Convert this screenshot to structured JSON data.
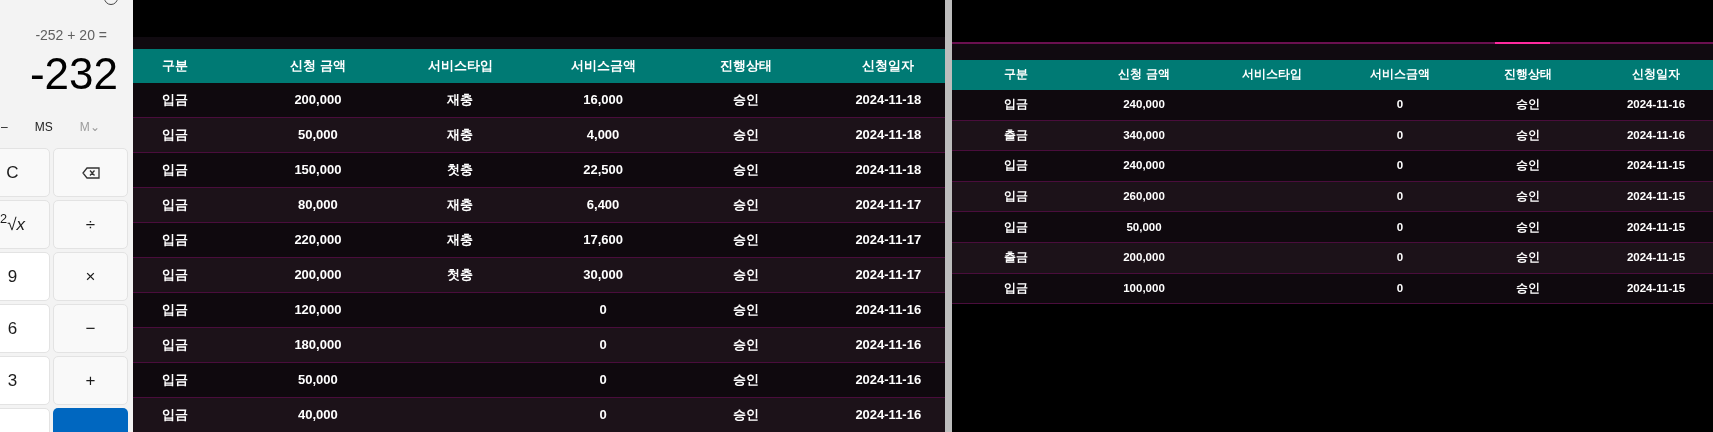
{
  "calculator": {
    "expression": "-252 + 20 =",
    "display": "-232",
    "memory_buttons": [
      "–",
      "MS",
      "M⌄"
    ],
    "keys": [
      {
        "kind": "text",
        "label": "C"
      },
      {
        "kind": "backspace"
      },
      {
        "kind": "text",
        "label": "$^{2}$√*x*"
      },
      {
        "kind": "text",
        "label": "÷"
      },
      {
        "kind": "number",
        "label": "9"
      },
      {
        "kind": "text",
        "label": "×"
      },
      {
        "kind": "number",
        "label": "6"
      },
      {
        "kind": "text",
        "label": "−"
      },
      {
        "kind": "number",
        "label": "3"
      },
      {
        "kind": "text",
        "label": "+"
      },
      {
        "kind": "number"
      },
      {
        "kind": "equals"
      }
    ]
  },
  "left_table": {
    "columns": [
      "구분",
      "신청 금액",
      "서비스타입",
      "서비스금액",
      "진행상태",
      "신청일자"
    ],
    "rows": [
      {
        "type": "입금",
        "amount": "200,000",
        "service_type": "재충",
        "service_amount": "16,000",
        "status": "승인",
        "date": "2024-11-18"
      },
      {
        "type": "입금",
        "amount": "50,000",
        "service_type": "재충",
        "service_amount": "4,000",
        "status": "승인",
        "date": "2024-11-18"
      },
      {
        "type": "입금",
        "amount": "150,000",
        "service_type": "첫충",
        "service_amount": "22,500",
        "status": "승인",
        "date": "2024-11-18"
      },
      {
        "type": "입금",
        "amount": "80,000",
        "service_type": "재충",
        "service_amount": "6,400",
        "status": "승인",
        "date": "2024-11-17"
      },
      {
        "type": "입금",
        "amount": "220,000",
        "service_type": "재충",
        "service_amount": "17,600",
        "status": "승인",
        "date": "2024-11-17"
      },
      {
        "type": "입금",
        "amount": "200,000",
        "service_type": "첫충",
        "service_amount": "30,000",
        "status": "승인",
        "date": "2024-11-17"
      },
      {
        "type": "입금",
        "amount": "120,000",
        "service_amount": "0",
        "status": "승인",
        "date": "2024-11-16"
      },
      {
        "type": "입금",
        "amount": "180,000",
        "service_amount": "0",
        "status": "승인",
        "date": "2024-11-16"
      },
      {
        "type": "입금",
        "amount": "50,000",
        "service_amount": "0",
        "status": "승인",
        "date": "2024-11-16"
      },
      {
        "type": "입금",
        "amount": "40,000",
        "service_amount": "0",
        "status": "승인",
        "date": "2024-11-16"
      }
    ]
  },
  "right_table": {
    "columns": [
      "구분",
      "신청 금액",
      "서비스타입",
      "서비스금액",
      "진행상태",
      "신청일자"
    ],
    "rows": [
      {
        "type": "입금",
        "amount": "240,000",
        "service_amount": "0",
        "status": "승인",
        "date": "2024-11-16"
      },
      {
        "type": "출금",
        "amount": "340,000",
        "service_amount": "0",
        "status": "승인",
        "date": "2024-11-16"
      },
      {
        "type": "입금",
        "amount": "240,000",
        "service_amount": "0",
        "status": "승인",
        "date": "2024-11-15"
      },
      {
        "type": "입금",
        "amount": "260,000",
        "service_amount": "0",
        "status": "승인",
        "date": "2024-11-15"
      },
      {
        "type": "입금",
        "amount": "50,000",
        "service_amount": "0",
        "status": "승인",
        "date": "2024-11-15"
      },
      {
        "type": "출금",
        "amount": "200,000",
        "service_amount": "0",
        "status": "승인",
        "date": "2024-11-15"
      },
      {
        "type": "입금",
        "amount": "100,000",
        "service_amount": "0",
        "status": "승인",
        "date": "2024-11-15"
      }
    ]
  }
}
